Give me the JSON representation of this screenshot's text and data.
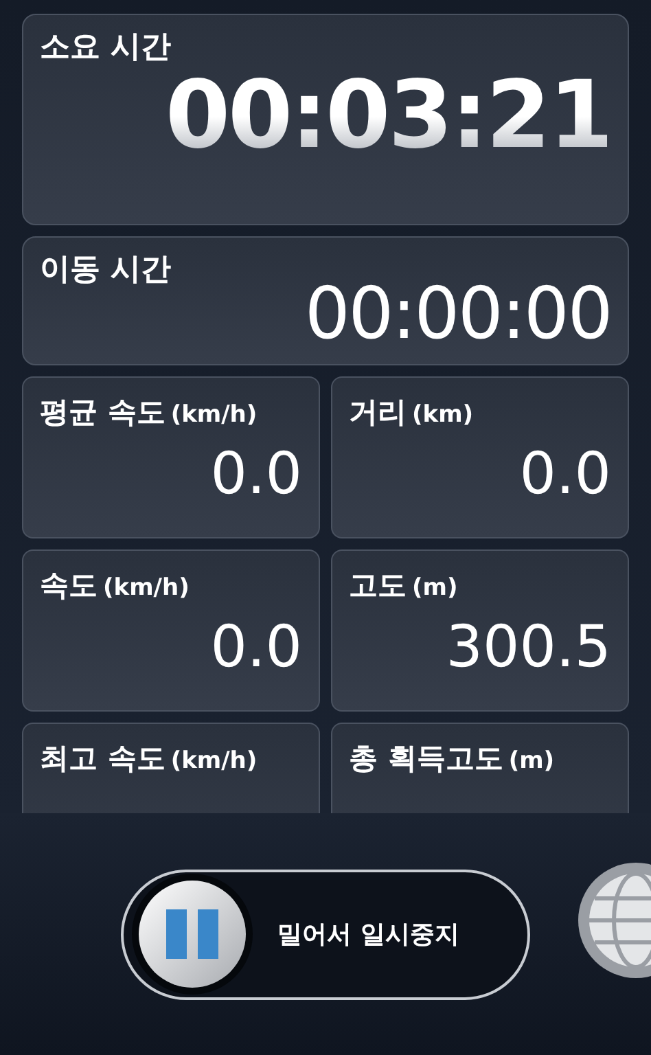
{
  "elapsed": {
    "label": "소요 시간",
    "value": "00:03:21"
  },
  "moving": {
    "label": "이동 시간",
    "value": "00:00:00"
  },
  "stats": [
    {
      "label": "평균 속도",
      "unit": "(km/h)",
      "value": "0.0"
    },
    {
      "label": "거리",
      "unit": "(km)",
      "value": "0.0"
    },
    {
      "label": "속도",
      "unit": "(km/h)",
      "value": "0.0"
    },
    {
      "label": "고도",
      "unit": "(m)",
      "value": "300.5"
    },
    {
      "label": "최고 속도",
      "unit": "(km/h)"
    },
    {
      "label": "총 획득고도",
      "unit": "(m)"
    }
  ],
  "slider": {
    "label": "밀어서 일시중지"
  }
}
